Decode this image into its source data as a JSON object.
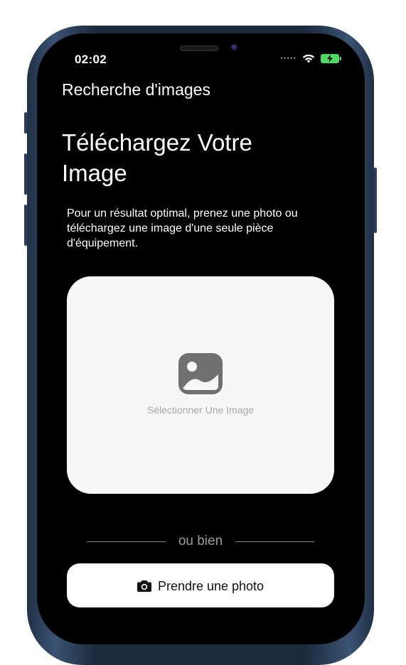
{
  "status_bar": {
    "time": "02:02",
    "signal_icon": "signal-dots-icon",
    "wifi_icon": "wifi-icon",
    "battery_icon": "battery-charging-icon",
    "battery_color": "#4cd964"
  },
  "header": {
    "title": "Recherche d'images"
  },
  "main": {
    "heading": "Téléchargez Votre Image",
    "description": "Pour un résultat optimal, prenez une photo ou téléchargez une image d'une seule pièce d'équipement.",
    "upload": {
      "icon": "image-placeholder-icon",
      "label": "Sélectionner Une Image",
      "card_color": "#f7f7f7"
    },
    "divider_text": "ou bien",
    "take_photo": {
      "icon": "camera-icon",
      "label": "Prendre une photo"
    }
  },
  "colors": {
    "screen_background": "#000000",
    "text_primary": "#ffffff",
    "text_muted": "#a8a8a8"
  }
}
